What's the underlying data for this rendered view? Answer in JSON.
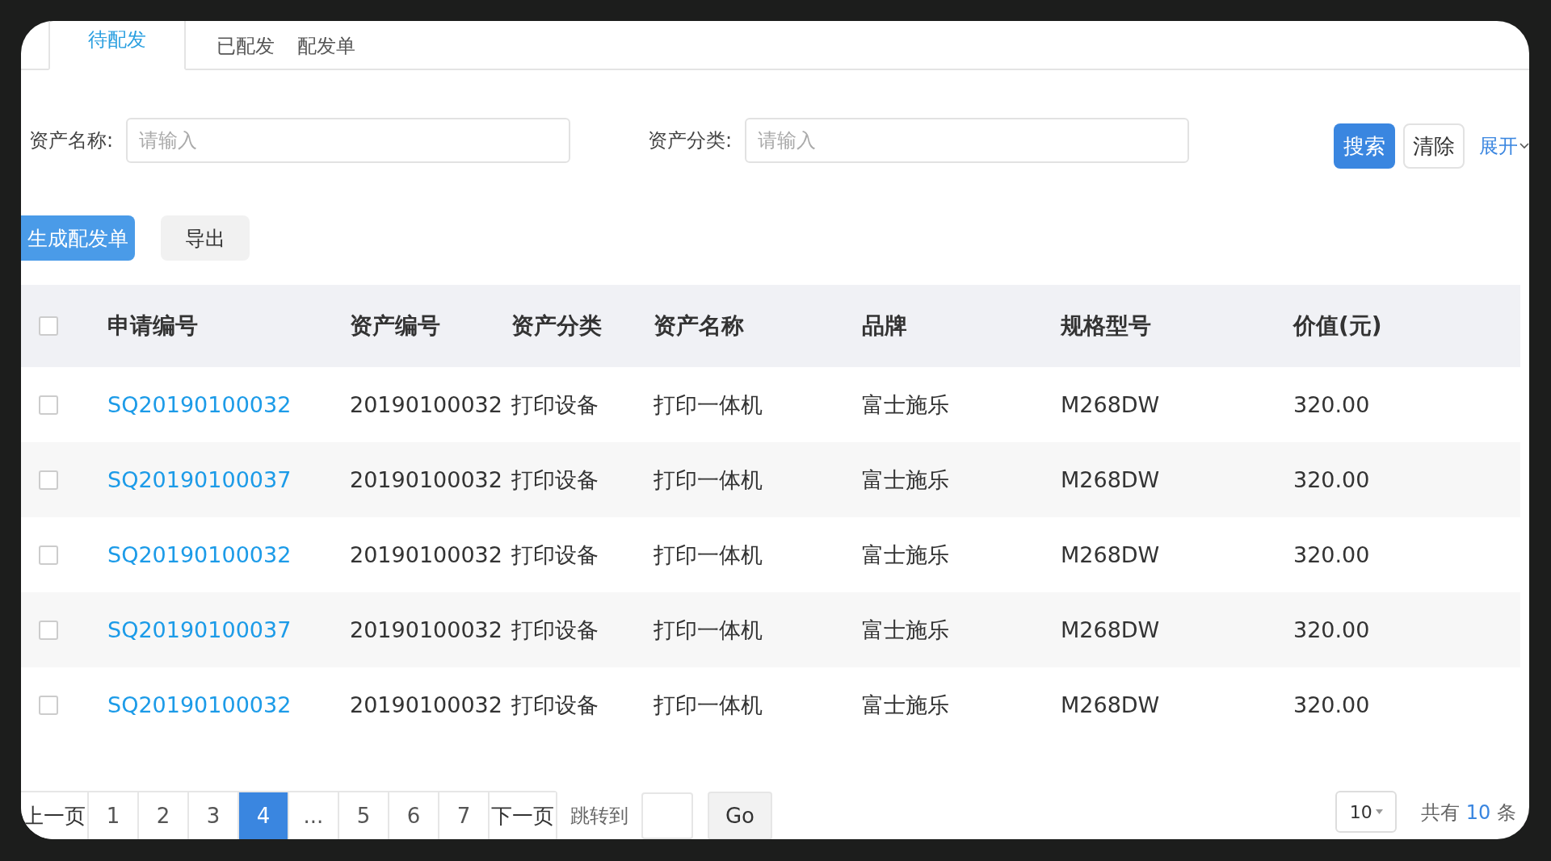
{
  "tabs": [
    {
      "label": "待配发",
      "selected": true
    },
    {
      "label": "已配发",
      "selected": false
    },
    {
      "label": "配发单",
      "selected": false
    }
  ],
  "filters": [
    {
      "label": "资产名称:",
      "placeholder": "请输入"
    },
    {
      "label": "资产分类:",
      "placeholder": "请输入"
    }
  ],
  "search_button": "搜索",
  "clear_button": "清除",
  "expand_link": "展开",
  "actions": [
    {
      "label": "生成配发单",
      "kind": "primary"
    },
    {
      "label": "导出",
      "kind": "default"
    }
  ],
  "table": {
    "select_all_checked": false,
    "columns": [
      "申请编号",
      "资产编号",
      "资产分类",
      "资产名称",
      "品牌",
      "规格型号",
      "价值(元)"
    ],
    "rows": [
      {
        "checked": false,
        "cells": [
          "SQ20190100032",
          "20190100032",
          "打印设备",
          "打印一体机",
          "富士施乐",
          "M268DW",
          "320.00"
        ]
      },
      {
        "checked": false,
        "cells": [
          "SQ20190100037",
          "20190100032",
          "打印设备",
          "打印一体机",
          "富士施乐",
          "M268DW",
          "320.00"
        ]
      },
      {
        "checked": false,
        "cells": [
          "SQ20190100032",
          "20190100032",
          "打印设备",
          "打印一体机",
          "富士施乐",
          "M268DW",
          "320.00"
        ]
      },
      {
        "checked": false,
        "cells": [
          "SQ20190100037",
          "20190100032",
          "打印设备",
          "打印一体机",
          "富士施乐",
          "M268DW",
          "320.00"
        ]
      },
      {
        "checked": false,
        "cells": [
          "SQ20190100032",
          "20190100032",
          "打印设备",
          "打印一体机",
          "富士施乐",
          "M268DW",
          "320.00"
        ]
      }
    ]
  },
  "pagination": {
    "prev": "上一页",
    "next": "下一页",
    "pages": [
      {
        "label": "1",
        "selected": false
      },
      {
        "label": "2",
        "selected": false
      },
      {
        "label": "3",
        "selected": false
      },
      {
        "label": "4",
        "selected": true
      },
      {
        "label": "...",
        "selected": false
      },
      {
        "label": "5",
        "selected": false
      },
      {
        "label": "6",
        "selected": false
      },
      {
        "label": "7",
        "selected": false
      }
    ],
    "jump_label": "跳转到",
    "go_button": "Go",
    "page_size": "10",
    "total_prefix": "共有",
    "total_count": "10",
    "total_suffix": "条"
  }
}
